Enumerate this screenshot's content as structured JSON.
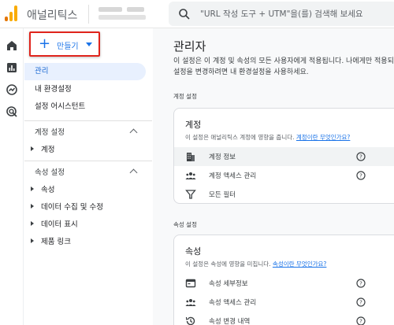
{
  "header": {
    "app_title": "애널리틱스",
    "search_placeholder": "\"URL 작성 도구 + UTM\"을(를) 검색해 보세요"
  },
  "rail": {
    "icons": [
      "home-icon",
      "reports-icon",
      "explore-icon",
      "advertising-icon"
    ]
  },
  "sidebar": {
    "create_label": "만들기",
    "top_items": [
      {
        "label": "관리",
        "active": true
      },
      {
        "label": "내 환경설정",
        "active": false
      },
      {
        "label": "설정 어시스턴트",
        "active": false
      }
    ],
    "account_section": {
      "title": "계정 설정",
      "items": [
        "계정"
      ]
    },
    "property_section": {
      "title": "속성 설정",
      "items": [
        "속성",
        "데이터 수집 및 수정",
        "데이터 표시",
        "제품 링크"
      ]
    }
  },
  "main": {
    "title": "관리자",
    "description": "이 설정은 이 계정 및 속성의 모든 사용자에게 적용됩니다. 나에게만 적용되는 설정을 변경하려면 내 환경설정을 사용하세요.",
    "account_settings_label": "계정 설정",
    "account_card": {
      "title": "계정",
      "desc": "이 설정은 애널리틱스 계정에 영향을 줍니다.",
      "link": "계정이란 무엇인가요?",
      "rows": [
        {
          "label": "계정 정보",
          "icon": "building-icon"
        },
        {
          "label": "계정 액세스 관리",
          "icon": "people-icon"
        },
        {
          "label": "모든 필터",
          "icon": "filter-icon"
        }
      ]
    },
    "property_settings_label": "속성 설정",
    "property_card": {
      "title": "속성",
      "desc": "이 설정은 속성에 영향을 미칩니다.",
      "link": "속성이란 무엇인가요?",
      "rows": [
        {
          "label": "속성 세부정보",
          "icon": "property-details-icon"
        },
        {
          "label": "속성 액세스 관리",
          "icon": "people-icon"
        },
        {
          "label": "속성 변경 내역",
          "icon": "history-icon"
        }
      ]
    }
  },
  "colors": {
    "accent": "#1a73e8",
    "active_bg": "#e8f0fe",
    "highlight_border": "#e0241c",
    "logo_orange": "#f9ab00",
    "logo_dark_orange": "#e37400"
  }
}
